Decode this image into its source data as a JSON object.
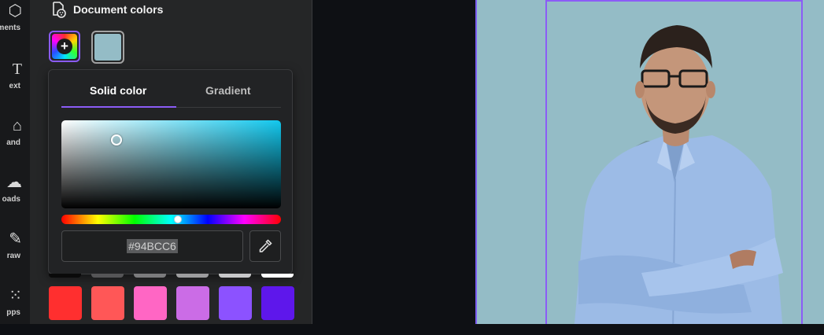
{
  "rail": {
    "items": [
      {
        "label": "ments",
        "icon": "elements-icon",
        "glyph": "⬡"
      },
      {
        "label": "ext",
        "icon": "text-icon",
        "glyph": "T"
      },
      {
        "label": "and",
        "icon": "brand-icon",
        "glyph": "⌂"
      },
      {
        "label": "oads",
        "icon": "uploads-icon",
        "glyph": "☁"
      },
      {
        "label": "raw",
        "icon": "draw-icon",
        "glyph": "✎"
      },
      {
        "label": "pps",
        "icon": "apps-icon",
        "glyph": "⁙"
      }
    ]
  },
  "panel": {
    "section_title": "Document colors",
    "document_swatch_color": "#94BCC6"
  },
  "picker": {
    "tabs": {
      "solid": "Solid color",
      "gradient": "Gradient"
    },
    "active_tab": "Solid color",
    "hex_value": "#94BCC6",
    "hue_fraction": 0.53
  },
  "palette": {
    "grey_row": [
      "#0a0a0a",
      "#555557",
      "#7b7b7d",
      "#9d9d9f",
      "#c8c8ca",
      "#ffffff"
    ],
    "color_row": [
      "#ff2f2f",
      "#ff5757",
      "#ff66c4",
      "#cb6ce6",
      "#8c52ff",
      "#5e17eb"
    ]
  },
  "canvas": {
    "background": "#94BCC6",
    "accent": "#8B5CF6"
  }
}
